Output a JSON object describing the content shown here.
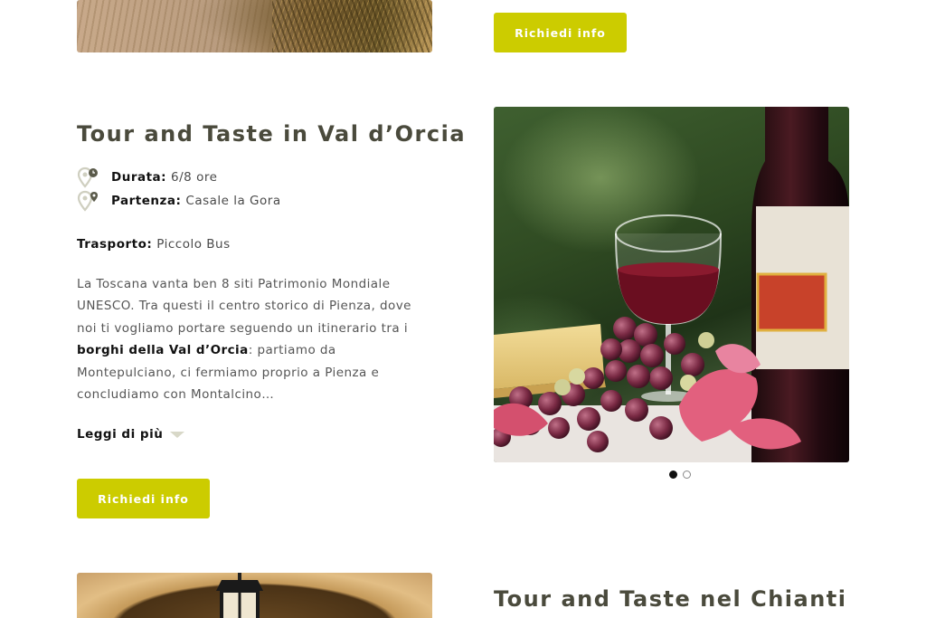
{
  "top_section": {
    "button_label": "Richiedi info"
  },
  "tour_orcia": {
    "title": "Tour and Taste in Val d’Orcia",
    "durata_label": "Durata:",
    "durata_value": "6/8 ore",
    "partenza_label": "Partenza:",
    "partenza_value": "Casale la Gora",
    "trasporto_label": "Trasporto:",
    "trasporto_value": "Piccolo Bus",
    "description_1": "La Toscana vanta ben 8 siti Patrimonio Mondiale UNESCO. Tra questi il centro storico di Pienza, dove noi ti vogliamo portare seguendo un itinerario tra i ",
    "description_bold": "borghi della Val d’Orcia",
    "description_2": ": partiamo da Montepulciano, ci fermiamo proprio a Pienza e concludiamo con Montalcino…",
    "read_more_label": "Leggi di più",
    "button_label": "Richiedi info",
    "carousel": {
      "slides": 2,
      "active_index": 0
    }
  },
  "tour_chianti": {
    "title": "Tour and Taste nel Chianti"
  },
  "colors": {
    "accent": "#cccc00",
    "title": "#4a4a3c"
  },
  "icons": {
    "durata": "map-pin-clock-icon",
    "partenza": "map-pin-location-icon",
    "read_more": "chevron-down-icon"
  }
}
